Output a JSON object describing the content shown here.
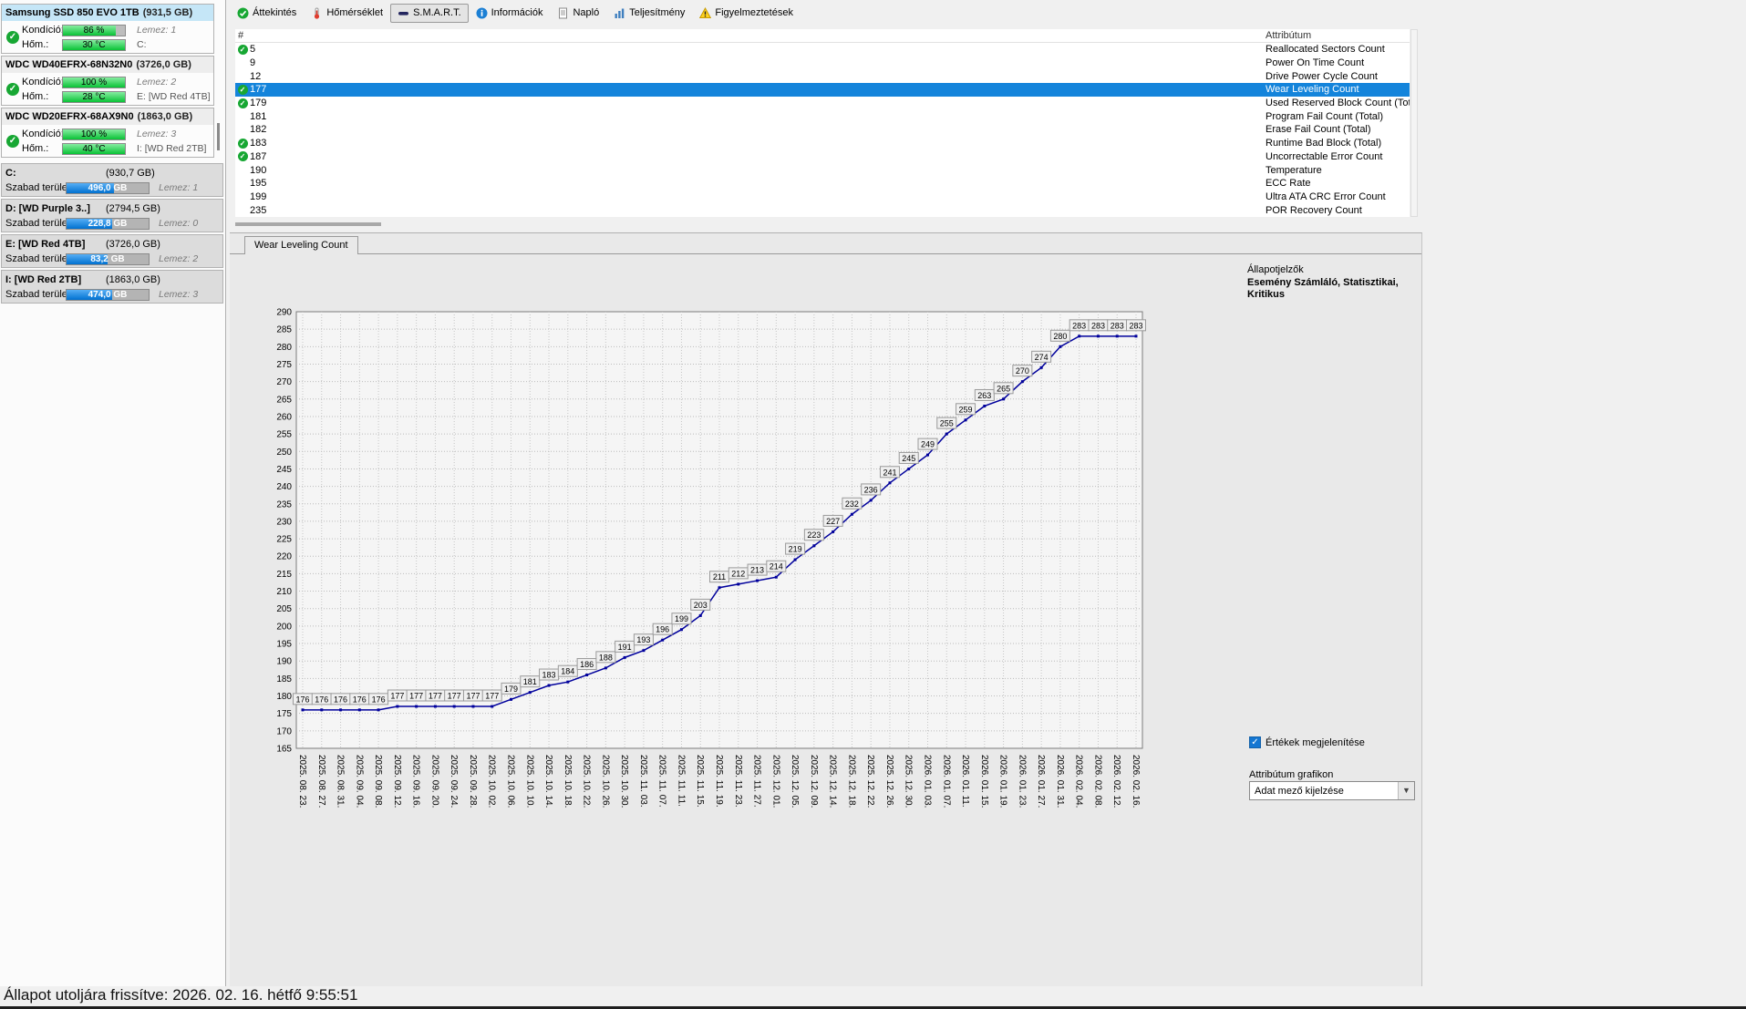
{
  "toolbar": {
    "items": [
      {
        "label": "Áttekintés"
      },
      {
        "label": "Hőmérséklet"
      },
      {
        "label": "S.M.A.R.T.",
        "active": true
      },
      {
        "label": "Információk"
      },
      {
        "label": "Napló"
      },
      {
        "label": "Teljesítmény"
      },
      {
        "label": "Figyelmeztetések"
      }
    ]
  },
  "sidebar": {
    "drives": [
      {
        "name": "Samsung SSD 850 EVO 1TB",
        "size": "(931,5 GB)",
        "selected": true,
        "check": true,
        "condition_label": "Kondíció:",
        "condition": "86 %",
        "condition_pct": 86,
        "disk": "Lemez: 1",
        "temp_label": "Hőm.:",
        "temp": "30 °C",
        "temp_pct": 100,
        "volume": "C:"
      },
      {
        "name": "WDC WD40EFRX-68N32N0",
        "size": "(3726,0 GB)",
        "selected": false,
        "check": true,
        "condition_label": "Kondíció:",
        "condition": "100 %",
        "condition_pct": 100,
        "disk": "Lemez: 2",
        "temp_label": "Hőm.:",
        "temp": "28 °C",
        "temp_pct": 100,
        "volume": "E: [WD Red 4TB]"
      },
      {
        "name": "WDC WD20EFRX-68AX9N0",
        "size": "(1863,0 GB)",
        "selected": false,
        "check": true,
        "condition_label": "Kondíció:",
        "condition": "100 %",
        "condition_pct": 100,
        "disk": "Lemez: 3",
        "temp_label": "Hőm.:",
        "temp": "40 °C",
        "temp_pct": 100,
        "volume": "I: [WD Red 2TB]"
      }
    ],
    "volumes": [
      {
        "name": "C:",
        "size": "(930,7 GB)",
        "free_label": "Szabad terület",
        "free": "496,0 GB",
        "free_pct": 58,
        "disk": "Lemez: 1"
      },
      {
        "name": "D: [WD Purple 3..]",
        "size": "(2794,5 GB)",
        "free_label": "Szabad terület",
        "free": "228,8 GB",
        "free_pct": 55,
        "disk": "Lemez: 0"
      },
      {
        "name": "E: [WD Red 4TB]",
        "size": "(3726,0 GB)",
        "free_label": "Szabad terület",
        "free": "83,2 GB",
        "free_pct": 50,
        "disk": "Lemez: 2"
      },
      {
        "name": "I: [WD Red 2TB]",
        "size": "(1863,0 GB)",
        "free_label": "Szabad terület",
        "free": "474,0 GB",
        "free_pct": 55,
        "disk": "Lemez: 3"
      }
    ]
  },
  "smart_table": {
    "columns": {
      "id": "#",
      "attr": "Attribútum"
    },
    "rows": [
      {
        "id": "5",
        "check": true,
        "selected": false,
        "attr": "Reallocated Sectors Count"
      },
      {
        "id": "9",
        "check": false,
        "selected": false,
        "attr": "Power On Time Count"
      },
      {
        "id": "12",
        "check": false,
        "selected": false,
        "attr": "Drive Power Cycle Count"
      },
      {
        "id": "177",
        "check": true,
        "selected": true,
        "attr": "Wear Leveling Count"
      },
      {
        "id": "179",
        "check": true,
        "selected": false,
        "attr": "Used Reserved Block Count (Total)"
      },
      {
        "id": "181",
        "check": false,
        "selected": false,
        "attr": "Program Fail Count (Total)"
      },
      {
        "id": "182",
        "check": false,
        "selected": false,
        "attr": "Erase Fail Count (Total)"
      },
      {
        "id": "183",
        "check": true,
        "selected": false,
        "attr": "Runtime Bad Block (Total)"
      },
      {
        "id": "187",
        "check": true,
        "selected": false,
        "attr": "Uncorrectable Error Count"
      },
      {
        "id": "190",
        "check": false,
        "selected": false,
        "attr": "Temperature"
      },
      {
        "id": "195",
        "check": false,
        "selected": false,
        "attr": "ECC Rate"
      },
      {
        "id": "199",
        "check": false,
        "selected": false,
        "attr": "Ultra ATA CRC Error Count"
      },
      {
        "id": "235",
        "check": false,
        "selected": false,
        "attr": "POR Recovery Count"
      }
    ]
  },
  "chart_tab": {
    "label": "Wear Leveling Count"
  },
  "right_panel": {
    "title": "Állapotjelzők",
    "subtitle": "Esemény Számláló, Statisztikai, Kritikus",
    "values_checkbox_label": "Értékek megjelenítése",
    "values_checkbox_checked": true,
    "group_label": "Attribútum grafikon",
    "dropdown_value": "Adat mező kijelzése"
  },
  "statusbar": {
    "text": "Állapot utoljára frissítve: 2026. 02. 16. hétfő 9:55:51"
  },
  "chart_data": {
    "type": "line",
    "title": "Wear Leveling Count",
    "x_labels": [
      "2025. 08. 23.",
      "2025. 08. 27.",
      "2025. 08. 31.",
      "2025. 09. 04.",
      "2025. 09. 08.",
      "2025. 09. 12.",
      "2025. 09. 16.",
      "2025. 09. 20.",
      "2025. 09. 24.",
      "2025. 09. 28.",
      "2025. 10. 02.",
      "2025. 10. 06.",
      "2025. 10. 10.",
      "2025. 10. 14.",
      "2025. 10. 18.",
      "2025. 10. 22.",
      "2025. 10. 26.",
      "2025. 10. 30.",
      "2025. 11. 03.",
      "2025. 11. 07.",
      "2025. 11. 11.",
      "2025. 11. 15.",
      "2025. 11. 19.",
      "2025. 11. 23.",
      "2025. 11. 27.",
      "2025. 12. 01.",
      "2025. 12. 05.",
      "2025. 12. 09.",
      "2025. 12. 14.",
      "2025. 12. 18.",
      "2025. 12. 22.",
      "2025. 12. 26.",
      "2025. 12. 30.",
      "2026. 01. 03.",
      "2026. 01. 07.",
      "2026. 01. 11.",
      "2026. 01. 15.",
      "2026. 01. 19.",
      "2026. 01. 23.",
      "2026. 01. 27.",
      "2026. 01. 31.",
      "2026. 02. 04.",
      "2026. 02. 08.",
      "2026. 02. 12.",
      "2026. 02. 16."
    ],
    "values": [
      176,
      176,
      176,
      176,
      176,
      177,
      177,
      177,
      177,
      177,
      177,
      179,
      181,
      183,
      184,
      186,
      188,
      191,
      193,
      196,
      199,
      203,
      211,
      212,
      213,
      214,
      219,
      223,
      227,
      232,
      236,
      241,
      245,
      249,
      255,
      259,
      263,
      265,
      270,
      274,
      280,
      283,
      283,
      283,
      283
    ],
    "ylim": [
      165,
      290
    ],
    "ytick_step": 5,
    "grid": true,
    "legend": "none",
    "line_color": "#00009c",
    "point_labels": true
  }
}
